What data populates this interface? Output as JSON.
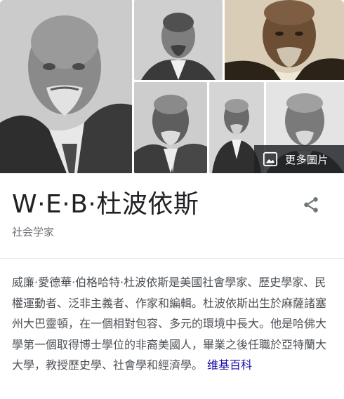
{
  "gallery": {
    "more_images_label": "更多圖片",
    "photos": [
      {
        "name": "portrait-main"
      },
      {
        "name": "portrait-young-suit"
      },
      {
        "name": "portrait-sepia"
      },
      {
        "name": "portrait-elder-seated"
      },
      {
        "name": "portrait-standing"
      },
      {
        "name": "portrait-bow-tie"
      }
    ]
  },
  "entity": {
    "title": "W·E·B·杜波依斯",
    "subtitle": "社会学家",
    "share_icon": "share-icon"
  },
  "description": {
    "text": "威廉·愛德華·伯格哈特·杜波依斯是美國社會學家、歷史學家、民權運動者、泛非主義者、作家和編輯。杜波依斯出生於麻薩諸塞州大巴靈頓，在一個相對包容、多元的環境中長大。他是哈佛大學第一個取得博士學位的非裔美國人，畢業之後任職於亞特蘭大大學，教授歷史學、社會學和經濟學。",
    "source_link": "维基百科"
  },
  "colors": {
    "title": "#202124",
    "subtitle": "#70757a",
    "body": "#4d5156",
    "link": "#1a0dab",
    "overlay": "#202124"
  }
}
